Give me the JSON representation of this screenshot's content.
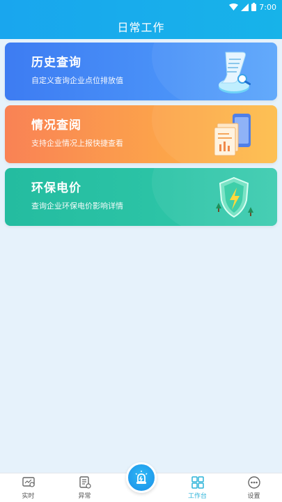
{
  "status_bar": {
    "time": "7:00"
  },
  "header": {
    "title": "日常工作"
  },
  "cards": [
    {
      "title": "历史查询",
      "subtitle": "自定义查询企业点位排放值",
      "icon": "scroll-chart-icon",
      "color": "#3d7cf2"
    },
    {
      "title": "情况查阅",
      "subtitle": "支持企业情况上报快捷查看",
      "icon": "documents-phone-icon",
      "color": "#f98255"
    },
    {
      "title": "环保电价",
      "subtitle": "查询企业环保电价影响详情",
      "icon": "shield-lightning-icon",
      "color": "#24bca0"
    }
  ],
  "tabs": [
    {
      "label": "实时",
      "icon": "monitor-icon"
    },
    {
      "label": "异常",
      "icon": "report-icon"
    },
    {
      "label": "",
      "icon": "alarm-siren-icon"
    },
    {
      "label": "工作台",
      "icon": "grid-icon",
      "active": true
    },
    {
      "label": "设置",
      "icon": "settings-icon"
    }
  ],
  "colors": {
    "header": "#19a6ee",
    "accent": "#2bb3d9",
    "background": "#e6f2fb"
  }
}
